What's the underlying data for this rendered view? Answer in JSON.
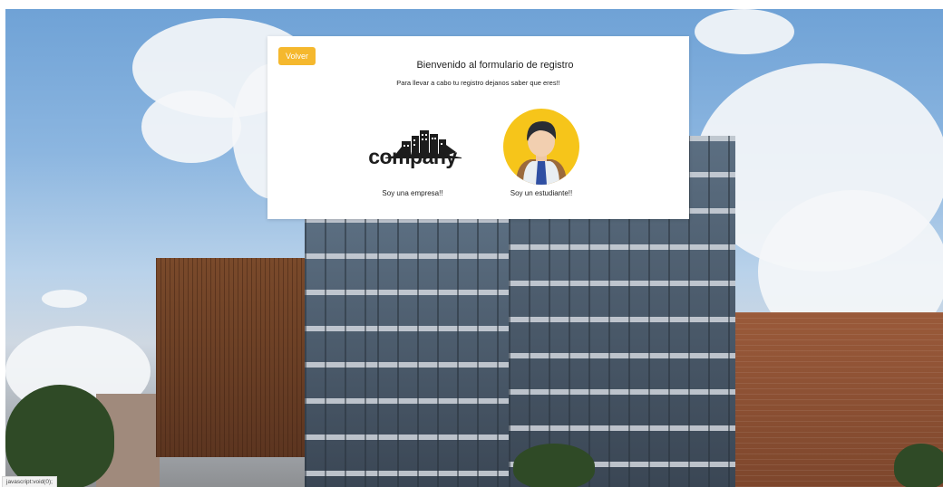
{
  "dialog": {
    "back_label": "Volver",
    "title": "Bienvenido al formulario de registro",
    "subtitle": "Para llevar a cabo tu registro dejanos saber que eres!!"
  },
  "options": [
    {
      "logo_text": "company",
      "caption": "Soy una empresa!!"
    },
    {
      "caption": "Soy un estudiante!!"
    }
  ],
  "status_bar": {
    "text": "javascript:void(0);"
  },
  "colors": {
    "accent": "#f5b82e",
    "avatar_bg": "#f6c51a"
  }
}
